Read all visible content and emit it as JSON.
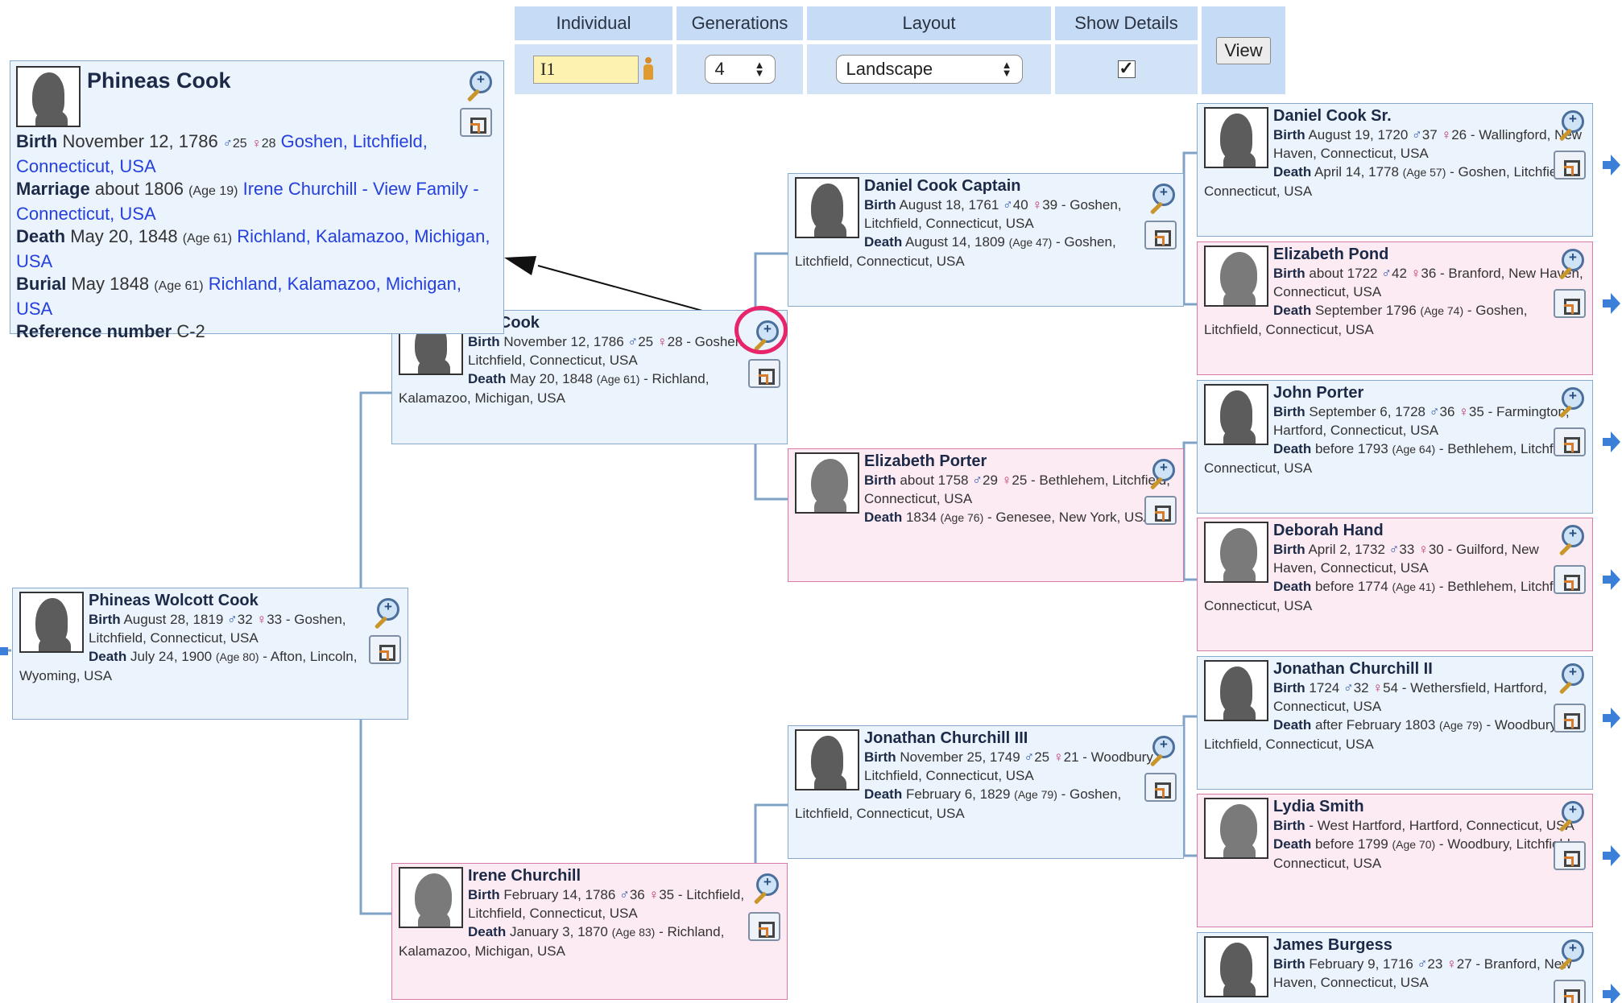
{
  "controls": {
    "headers": [
      "Individual",
      "Generations",
      "Layout",
      "Show Details"
    ],
    "individual_value": "I1",
    "generations_value": "4",
    "layout_value": "Landscape",
    "show_details_checked": true,
    "view_label": "View"
  },
  "popup": {
    "name": "Phineas Cook",
    "birth_label": "Birth",
    "birth_date": "November 12, 1786",
    "birth_father_age": "25",
    "birth_mother_age": "28",
    "birth_place": "Goshen, Litchfield, Connecticut, USA",
    "marriage_label": "Marriage",
    "marriage_date": "about 1806",
    "marriage_age": "(Age 19)",
    "marriage_spouse": "Irene Churchill",
    "marriage_link": "- View Family",
    "marriage_place": "- Connecticut, USA",
    "death_label": "Death",
    "death_date": "May 20, 1848",
    "death_age": "(Age 61)",
    "death_place": "Richland, Kalamazoo, Michigan, USA",
    "burial_label": "Burial",
    "burial_date": "May 1848",
    "burial_age": "(Age 61)",
    "burial_place": "Richland, Kalamazoo, Michigan, USA",
    "ref_label": "Reference number",
    "ref_value": "C-2"
  },
  "people": {
    "root": {
      "name": "Phineas Wolcott Cook",
      "birth": "August 28, 1819",
      "fa": "32",
      "ma": "33",
      "birth_place": "- Goshen, Litchfield, Connecticut, USA",
      "death": "July 24, 1900",
      "death_age": "(Age 80)",
      "death_place": "- Afton, Lincoln, Wyoming, USA"
    },
    "p1": {
      "name_visible": "eas Cook",
      "birth": "November 12, 1786",
      "fa": "25",
      "ma": "28",
      "birth_place": "- Goshen, Litchfield, Connecticut, USA",
      "death": "May 20, 1848",
      "death_age": "(Age 61)",
      "death_place": "- Richland, Kalamazoo, Michigan, USA"
    },
    "p2": {
      "name": "Irene Churchill",
      "birth": "February 14, 1786",
      "fa": "36",
      "ma": "35",
      "birth_place": "- Litchfield, Litchfield, Connecticut, USA",
      "death": "January 3, 1870",
      "death_age": "(Age 83)",
      "death_place": "- Richland, Kalamazoo, Michigan, USA"
    },
    "g1": {
      "name": "Daniel Cook Captain",
      "birth": "August 18, 1761",
      "fa": "40",
      "ma": "39",
      "birth_place": "- Goshen, Litchfield, Connecticut, USA",
      "death": "August 14, 1809",
      "death_age": "(Age 47)",
      "death_place": "- Goshen, Litchfield, Connecticut, USA"
    },
    "g2": {
      "name": "Elizabeth Porter",
      "birth": "about 1758",
      "fa": "29",
      "ma": "25",
      "birth_place": "- Bethlehem, Litchfield, Connecticut, USA",
      "death": "1834",
      "death_age": "(Age 76)",
      "death_place": "- Genesee, New York, USA"
    },
    "g3": {
      "name": "Jonathan Churchill III",
      "birth": "November 25, 1749",
      "fa": "25",
      "ma": "21",
      "birth_place": "- Woodbury, Litchfield, Connecticut, USA",
      "death": "February 6, 1829",
      "death_age": "(Age 79)",
      "death_place": "- Goshen, Litchfield, Connecticut, USA"
    },
    "gg1": {
      "name": "Daniel Cook Sr.",
      "birth": "August 19, 1720",
      "fa": "37",
      "ma": "26",
      "birth_place": "- Wallingford, New Haven, Connecticut, USA",
      "death": "April 14, 1778",
      "death_age": "(Age 57)",
      "death_place": "- Goshen, Litchfield, Connecticut, USA"
    },
    "gg2": {
      "name": "Elizabeth Pond",
      "birth": "about 1722",
      "fa": "42",
      "ma": "36",
      "birth_place": "- Branford, New Haven, Connecticut, USA",
      "death": "September 1796",
      "death_age": "(Age 74)",
      "death_place": "- Goshen, Litchfield, Connecticut, USA"
    },
    "gg3": {
      "name": "John Porter",
      "birth": "September 6, 1728",
      "fa": "36",
      "ma": "35",
      "birth_place": "- Farmington, Hartford, Connecticut, USA",
      "death": "before 1793",
      "death_age": "(Age 64)",
      "death_place": "- Bethlehem, Litchfield, Connecticut, USA"
    },
    "gg4": {
      "name": "Deborah Hand",
      "birth": "April 2, 1732",
      "fa": "33",
      "ma": "30",
      "birth_place": "- Guilford, New Haven, Connecticut, USA",
      "death": "before 1774",
      "death_age": "(Age 41)",
      "death_place": "- Bethlehem, Litchfield, Connecticut, USA"
    },
    "gg5": {
      "name": "Jonathan Churchill II",
      "birth": "1724",
      "fa": "32",
      "ma": "54",
      "birth_place": "- Wethersfield, Hartford, Connecticut, USA",
      "death": "after February 1803",
      "death_age": "(Age 79)",
      "death_place": "- Woodbury, Litchfield, Connecticut, USA"
    },
    "gg6": {
      "name": "Lydia Smith",
      "birth_place": "- West Hartford, Hartford, Connecticut, USA",
      "death": "before 1799",
      "death_age": "(Age 70)",
      "death_place": "- Woodbury, Litchfield, Connecticut, USA"
    },
    "gg7": {
      "name": "James Burgess",
      "birth": "February 9, 1716",
      "fa": "23",
      "ma": "27",
      "birth_place": "- Branford, New Haven, Connecticut, USA"
    }
  },
  "labels": {
    "birth": "Birth",
    "death": "Death",
    "male_symbol": "♂",
    "female_symbol": "♀"
  },
  "colors": {
    "male_box": "#ebf3fc",
    "female_box": "#fcebf2",
    "highlight": "#e8246a"
  }
}
